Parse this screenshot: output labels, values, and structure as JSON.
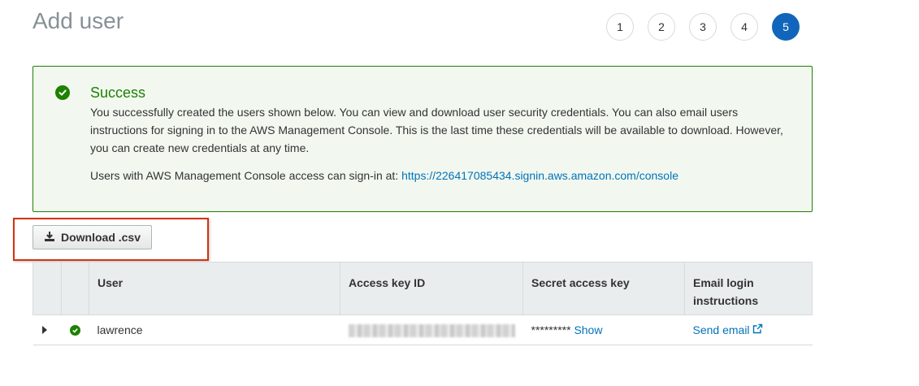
{
  "page": {
    "title": "Add user"
  },
  "steps": [
    "1",
    "2",
    "3",
    "4",
    "5"
  ],
  "active_step": "5",
  "alert": {
    "title": "Success",
    "message": "You successfully created the users shown below. You can view and download user security credentials. You can also email users instructions for signing in to the AWS Management Console. This is the last time these credentials will be available to download. However, you can create new credentials at any time.",
    "signin_prefix": "Users with AWS Management Console access can sign-in at: ",
    "signin_url": "https://226417085434.signin.aws.amazon.com/console",
    "color": "#1d8102"
  },
  "download": {
    "label": "Download .csv",
    "icon": "download-icon"
  },
  "table": {
    "headers": [
      "User",
      "Access key ID",
      "Secret access key",
      "Email login instructions"
    ],
    "rows": [
      {
        "user": "lawrence",
        "access_key_id": "",
        "secret_mask": "*********",
        "show_label": "Show",
        "email_label": "Send email"
      }
    ]
  },
  "colors": {
    "accent": "#1166bb",
    "link": "#0073bb",
    "highlight": "#d13212"
  }
}
